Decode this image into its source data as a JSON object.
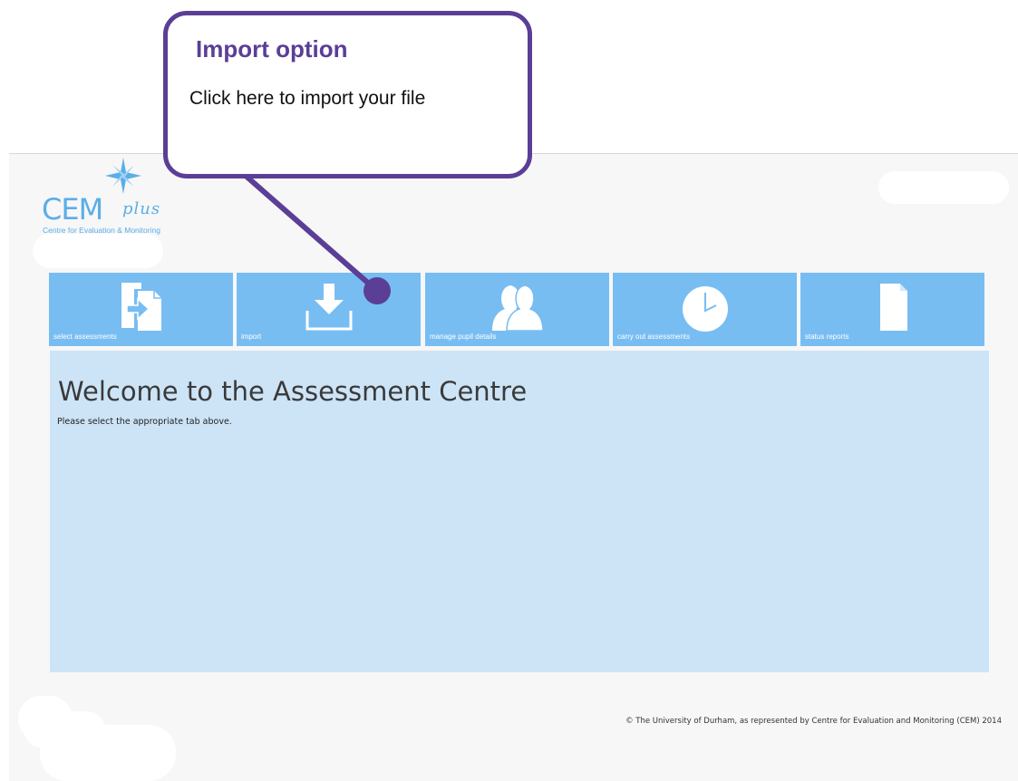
{
  "logo": {
    "brand": "CEM",
    "suffix": "plus",
    "tagline": "Centre for Evaluation & Monitoring"
  },
  "nav_tiles": [
    {
      "label": "select assessments",
      "icon": "select-assessments-icon"
    },
    {
      "label": "import",
      "icon": "import-icon"
    },
    {
      "label": "manage pupil details",
      "icon": "pupils-icon"
    },
    {
      "label": "carry out assessments",
      "icon": "clock-icon"
    },
    {
      "label": "status reports",
      "icon": "document-icon"
    }
  ],
  "main": {
    "title": "Welcome to the Assessment Centre",
    "instruction": "Please select the appropriate tab above."
  },
  "footer": {
    "copyright": "© The University of Durham, as represented by Centre for Evaluation and Monitoring (CEM) 2014"
  },
  "callout": {
    "title": "Import option",
    "text": "Click here to import your file"
  },
  "colors": {
    "tile": "#78bdf2",
    "content": "#cde4f7",
    "callout": "#5b3e96",
    "logo": "#5aaee8"
  }
}
